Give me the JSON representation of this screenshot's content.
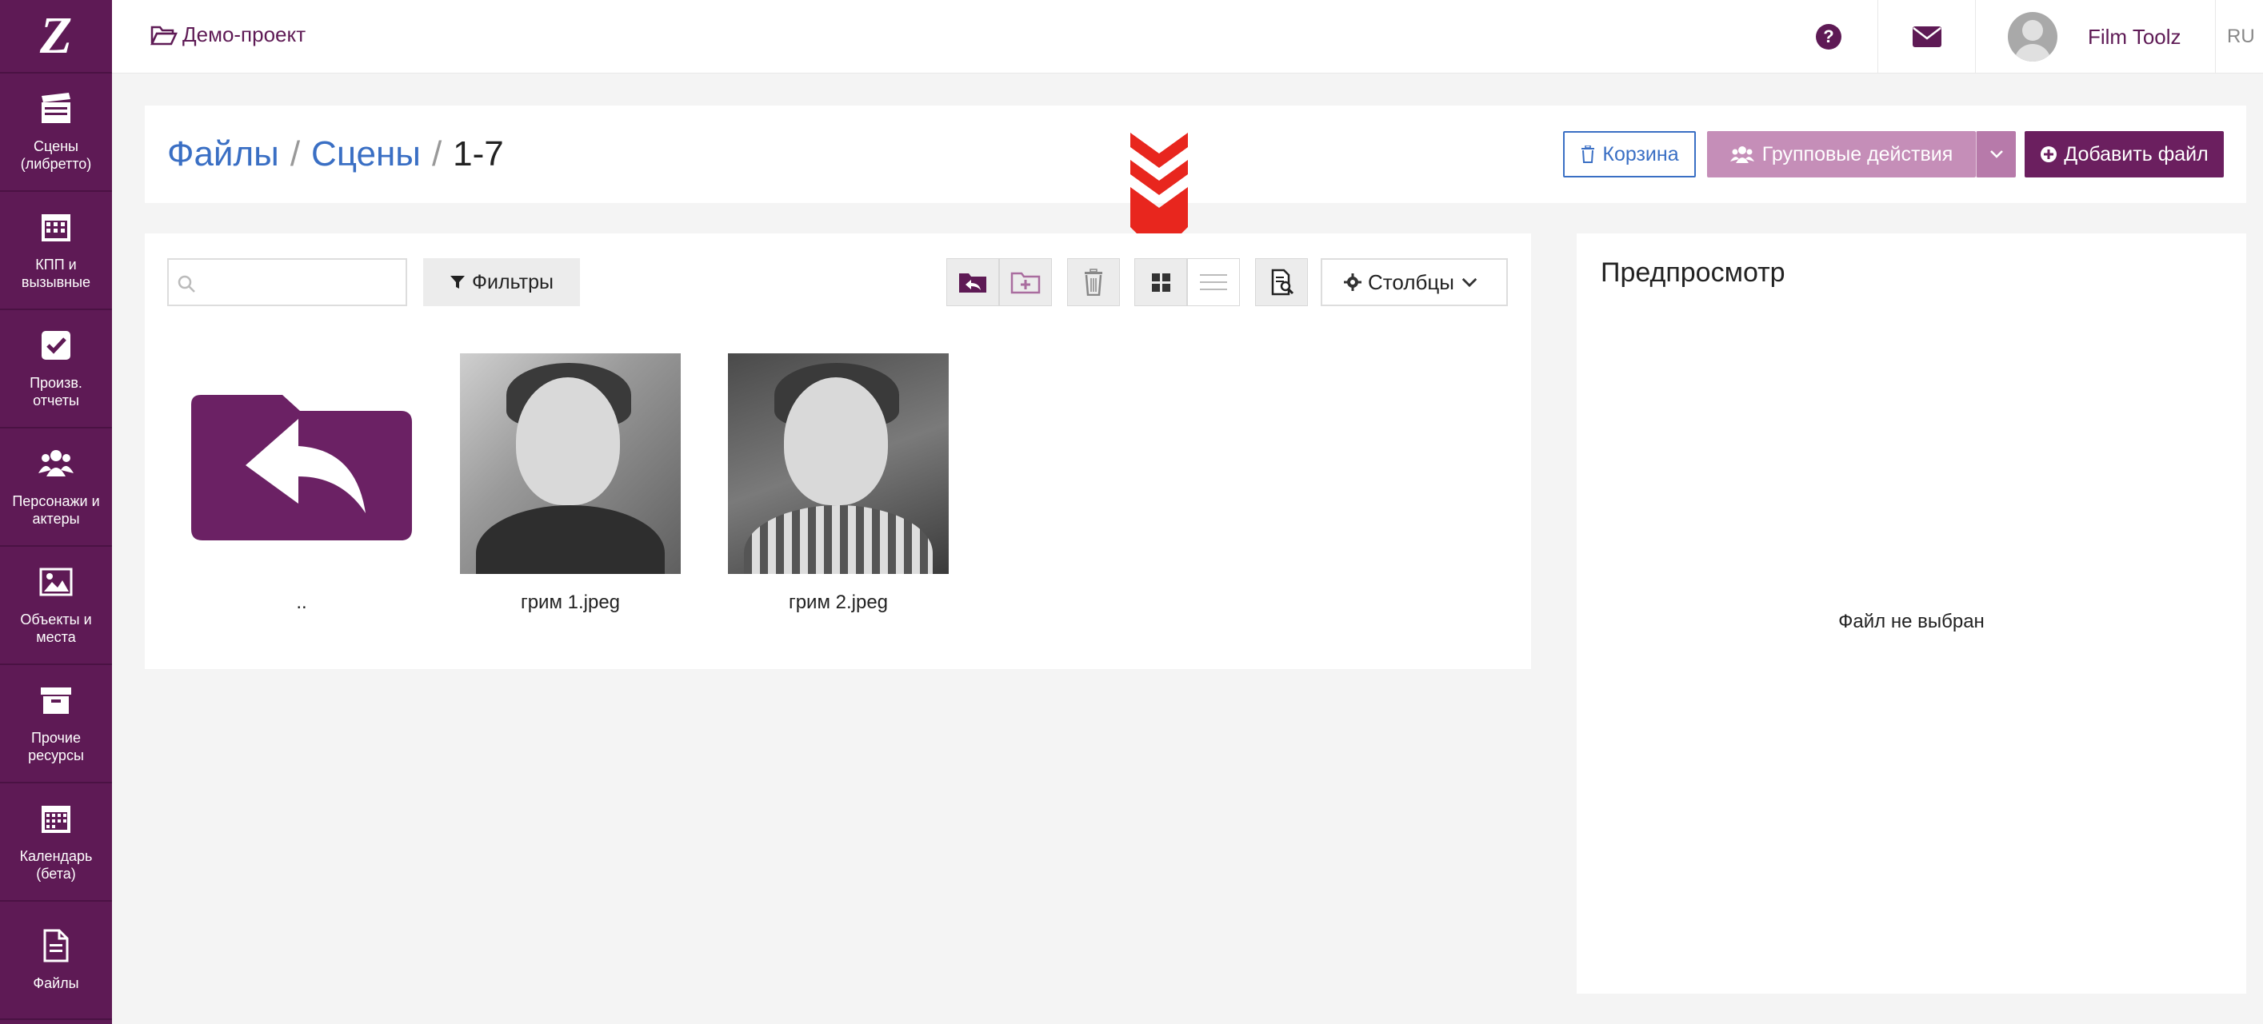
{
  "sidebar": {
    "logo": "Z",
    "items": [
      {
        "label": "Сцены\n(либретто)",
        "icon": "clapperboard-icon"
      },
      {
        "label": "КПП и\nвызывные",
        "icon": "calendar-grid-icon"
      },
      {
        "label": "Произв. отчеты",
        "icon": "checkbox-icon"
      },
      {
        "label": "Персонажи и\nактеры",
        "icon": "users-icon"
      },
      {
        "label": "Объекты и\nместа",
        "icon": "image-icon"
      },
      {
        "label": "Прочие\nресурсы",
        "icon": "archive-icon"
      },
      {
        "label": "Календарь\n(бета)",
        "icon": "calendar-icon"
      },
      {
        "label": "Файлы",
        "icon": "file-icon"
      }
    ]
  },
  "topbar": {
    "project": "Демо-проект",
    "username": "Film Toolz",
    "lang": "RU"
  },
  "breadcrumb": {
    "part1": "Файлы",
    "part2": "Сцены",
    "current": "1-7",
    "sep": "/"
  },
  "actions": {
    "trash": "Корзина",
    "group": "Групповые действия",
    "add": "Добавить файл"
  },
  "toolbar": {
    "search_placeholder": "",
    "filters": "Фильтры",
    "columns": "Столбцы"
  },
  "files": [
    {
      "name": "..",
      "type": "parent-folder"
    },
    {
      "name": "грим 1.jpeg",
      "type": "image"
    },
    {
      "name": "грим 2.jpeg",
      "type": "image"
    }
  ],
  "preview": {
    "title": "Предпросмотр",
    "empty": "Файл не выбран"
  },
  "colors": {
    "brand": "#5e1a55",
    "link": "#3a6fc4",
    "annotation": "#e8261e"
  }
}
